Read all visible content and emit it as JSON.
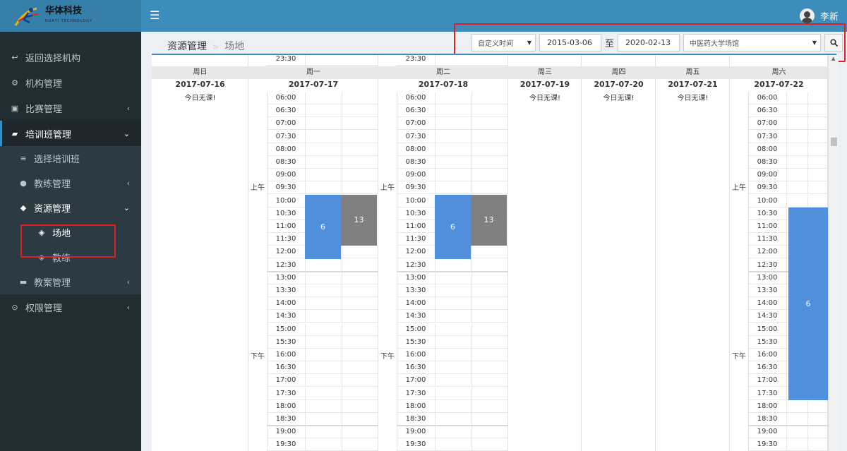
{
  "app": {
    "logo": "华体科技",
    "logo_sub": "HUATI TECHNOLOGY",
    "user": "李新"
  },
  "sidebar": [
    {
      "label": "返回选择机构",
      "icon": "↩",
      "name": "sidebar-item-back"
    },
    {
      "label": "机构管理",
      "icon": "⚙",
      "name": "sidebar-item-org"
    },
    {
      "label": "比赛管理",
      "icon": "▣",
      "name": "sidebar-item-match",
      "arrow": "‹"
    },
    {
      "label": "培训班管理",
      "icon": "▰",
      "name": "sidebar-item-training",
      "arrow": "⌄"
    }
  ],
  "submenu": [
    {
      "label": "选择培训班",
      "icon": "≡",
      "name": "sidebar-item-select-class"
    },
    {
      "label": "教练管理",
      "icon": "●",
      "name": "sidebar-item-coach-mgmt",
      "arrow": "‹"
    },
    {
      "label": "资源管理",
      "icon": "◆",
      "name": "sidebar-item-resource",
      "arrow": "⌄"
    },
    {
      "label": "场地",
      "icon": "◈",
      "name": "sidebar-item-venue"
    },
    {
      "label": "教练",
      "icon": "◈",
      "name": "sidebar-item-coach"
    },
    {
      "label": "教案管理",
      "icon": "▬",
      "name": "sidebar-item-lesson",
      "arrow": "‹"
    }
  ],
  "sidebar_last": {
    "label": "权限管理",
    "icon": "⊙",
    "arrow": "‹"
  },
  "breadcrumb": {
    "parent": "资源管理",
    "sep": ">",
    "current": "场地"
  },
  "filters": {
    "mode": "自定义时间",
    "start": "2015-03-06",
    "to": "至",
    "end": "2020-02-13",
    "venue": "中医药大学场馆"
  },
  "calendar": {
    "top_time": "23:30",
    "days": [
      {
        "week": "周日",
        "date": "2017-07-16",
        "empty": "今日无课!"
      },
      {
        "week": "周一",
        "date": "2017-07-17"
      },
      {
        "week": "周二",
        "date": "2017-07-18"
      },
      {
        "week": "周三",
        "date": "2017-07-19",
        "empty": "今日无课!"
      },
      {
        "week": "周四",
        "date": "2017-07-20",
        "empty": "今日无课!"
      },
      {
        "week": "周五",
        "date": "2017-07-21",
        "empty": "今日无课!"
      },
      {
        "week": "周六",
        "date": "2017-07-22"
      }
    ],
    "am": "上午",
    "pm": "下午",
    "times": [
      "06:00",
      "06:30",
      "07:00",
      "07:30",
      "08:00",
      "08:30",
      "09:00",
      "09:30",
      "10:00",
      "10:30",
      "11:00",
      "11:30",
      "12:00",
      "12:30",
      "13:00",
      "13:30",
      "14:00",
      "14:30",
      "15:00",
      "15:30",
      "16:00",
      "16:30",
      "17:00",
      "17:30",
      "18:00",
      "18:30",
      "19:00",
      "19:30"
    ],
    "blocks": {
      "mon_a": "6",
      "mon_b": "13",
      "tue_a": "6",
      "tue_b": "13",
      "sat_a": "6"
    },
    "colors": {
      "blue": "#4f8fdb",
      "gray": "#808080"
    }
  }
}
